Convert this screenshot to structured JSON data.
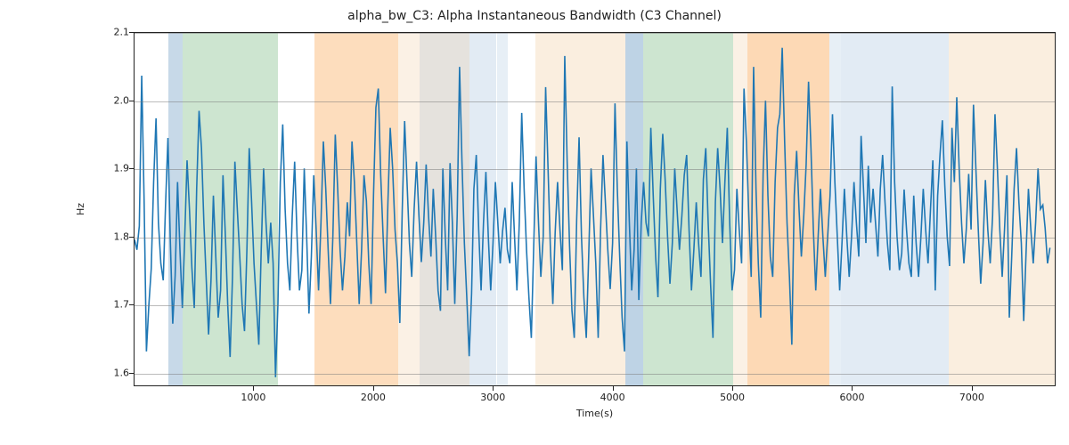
{
  "chart_data": {
    "type": "line",
    "title": "alpha_bw_C3: Alpha Instantaneous Bandwidth (C3 Channel)",
    "xlabel": "Time(s)",
    "ylabel": "Hz",
    "xlim": [
      0,
      7700
    ],
    "ylim": [
      1.58,
      2.1
    ],
    "xticks": [
      1000,
      2000,
      3000,
      4000,
      5000,
      6000,
      7000
    ],
    "yticks": [
      1.6,
      1.7,
      1.8,
      1.9,
      2.0,
      2.1
    ],
    "bands": [
      {
        "x0": 280,
        "x1": 400,
        "color": "rgba(70,130,180,0.30)"
      },
      {
        "x0": 400,
        "x1": 1200,
        "color": "rgba(90,170,100,0.30)"
      },
      {
        "x0": 1500,
        "x1": 2200,
        "color": "rgba(250,170,90,0.40)"
      },
      {
        "x0": 2200,
        "x1": 2800,
        "color": "rgba(240,200,150,0.25)"
      },
      {
        "x0": 2380,
        "x1": 3020,
        "color": "rgba(160,190,220,0.30)"
      },
      {
        "x0": 3030,
        "x1": 3120,
        "color": "rgba(160,190,220,0.25)"
      },
      {
        "x0": 3350,
        "x1": 4100,
        "color": "rgba(240,200,150,0.30)"
      },
      {
        "x0": 4100,
        "x1": 4250,
        "color": "rgba(70,130,180,0.35)"
      },
      {
        "x0": 4250,
        "x1": 5000,
        "color": "rgba(90,170,100,0.30)"
      },
      {
        "x0": 5000,
        "x1": 5120,
        "color": "rgba(240,200,150,0.25)"
      },
      {
        "x0": 5120,
        "x1": 5800,
        "color": "rgba(250,170,90,0.45)"
      },
      {
        "x0": 5800,
        "x1": 5900,
        "color": "rgba(160,190,220,0.25)"
      },
      {
        "x0": 5900,
        "x1": 6800,
        "color": "rgba(160,190,220,0.30)"
      },
      {
        "x0": 6800,
        "x1": 7700,
        "color": "rgba(240,200,150,0.30)"
      }
    ],
    "series": [
      {
        "name": "alpha_bw_C3",
        "color": "#1f77b4",
        "x_step": 20,
        "x_start": 0,
        "values": [
          1.795,
          1.78,
          1.815,
          2.037,
          1.852,
          1.63,
          1.698,
          1.752,
          1.88,
          1.974,
          1.82,
          1.76,
          1.735,
          1.846,
          1.945,
          1.792,
          1.671,
          1.742,
          1.88,
          1.78,
          1.694,
          1.8,
          1.912,
          1.84,
          1.754,
          1.694,
          1.87,
          1.985,
          1.93,
          1.82,
          1.738,
          1.655,
          1.734,
          1.86,
          1.77,
          1.68,
          1.72,
          1.89,
          1.8,
          1.7,
          1.622,
          1.74,
          1.91,
          1.84,
          1.772,
          1.7,
          1.66,
          1.78,
          1.93,
          1.85,
          1.76,
          1.7,
          1.64,
          1.78,
          1.9,
          1.82,
          1.76,
          1.82,
          1.76,
          1.592,
          1.7,
          1.88,
          1.965,
          1.84,
          1.76,
          1.72,
          1.83,
          1.91,
          1.8,
          1.72,
          1.75,
          1.9,
          1.8,
          1.686,
          1.77,
          1.89,
          1.81,
          1.72,
          1.82,
          1.94,
          1.87,
          1.78,
          1.7,
          1.8,
          1.95,
          1.87,
          1.78,
          1.72,
          1.77,
          1.85,
          1.8,
          1.94,
          1.88,
          1.79,
          1.7,
          1.78,
          1.89,
          1.852,
          1.76,
          1.7,
          1.86,
          1.99,
          2.018,
          1.89,
          1.8,
          1.716,
          1.85,
          1.96,
          1.9,
          1.81,
          1.76,
          1.672,
          1.838,
          1.97,
          1.88,
          1.79,
          1.74,
          1.84,
          1.91,
          1.83,
          1.762,
          1.82,
          1.906,
          1.83,
          1.77,
          1.87,
          1.8,
          1.72,
          1.69,
          1.9,
          1.8,
          1.72,
          1.908,
          1.82,
          1.7,
          1.83,
          2.05,
          1.91,
          1.79,
          1.71,
          1.623,
          1.715,
          1.87,
          1.92,
          1.81,
          1.72,
          1.82,
          1.895,
          1.8,
          1.72,
          1.79,
          1.88,
          1.82,
          1.76,
          1.808,
          1.842,
          1.78,
          1.76,
          1.88,
          1.8,
          1.72,
          1.822,
          1.982,
          1.87,
          1.78,
          1.71,
          1.65,
          1.78,
          1.918,
          1.822,
          1.74,
          1.8,
          2.02,
          1.9,
          1.78,
          1.7,
          1.805,
          1.88,
          1.81,
          1.75,
          2.066,
          1.91,
          1.786,
          1.69,
          1.65,
          1.824,
          1.946,
          1.8,
          1.71,
          1.65,
          1.77,
          1.9,
          1.83,
          1.76,
          1.65,
          1.81,
          1.92,
          1.85,
          1.78,
          1.722,
          1.79,
          1.996,
          1.87,
          1.77,
          1.68,
          1.63,
          1.94,
          1.822,
          1.72,
          1.78,
          1.9,
          1.706,
          1.82,
          1.88,
          1.82,
          1.8,
          1.96,
          1.86,
          1.77,
          1.71,
          1.87,
          1.951,
          1.884,
          1.8,
          1.73,
          1.79,
          1.9,
          1.84,
          1.78,
          1.83,
          1.89,
          1.92,
          1.81,
          1.72,
          1.78,
          1.85,
          1.79,
          1.74,
          1.884,
          1.93,
          1.82,
          1.73,
          1.65,
          1.85,
          1.93,
          1.87,
          1.79,
          1.88,
          1.96,
          1.82,
          1.72,
          1.75,
          1.87,
          1.81,
          1.76,
          2.018,
          1.94,
          1.83,
          1.74,
          2.05,
          1.87,
          1.76,
          1.68,
          1.892,
          2.0,
          1.86,
          1.77,
          1.74,
          1.88,
          1.96,
          1.98,
          2.078,
          1.94,
          1.82,
          1.74,
          1.64,
          1.86,
          1.926,
          1.84,
          1.77,
          1.83,
          1.906,
          2.028,
          1.93,
          1.81,
          1.72,
          1.8,
          1.87,
          1.8,
          1.74,
          1.8,
          1.86,
          1.98,
          1.88,
          1.8,
          1.72,
          1.79,
          1.87,
          1.8,
          1.74,
          1.8,
          1.88,
          1.82,
          1.77,
          1.948,
          1.87,
          1.79,
          1.904,
          1.82,
          1.87,
          1.82,
          1.77,
          1.87,
          1.92,
          1.85,
          1.79,
          1.75,
          2.021,
          1.88,
          1.8,
          1.75,
          1.775,
          1.869,
          1.81,
          1.76,
          1.74,
          1.86,
          1.79,
          1.74,
          1.8,
          1.87,
          1.81,
          1.76,
          1.838,
          1.912,
          1.72,
          1.86,
          1.921,
          1.971,
          1.876,
          1.8,
          1.756,
          1.96,
          1.88,
          2.005,
          1.9,
          1.82,
          1.76,
          1.81,
          1.892,
          1.81,
          1.994,
          1.9,
          1.81,
          1.73,
          1.79,
          1.883,
          1.81,
          1.76,
          1.83,
          1.98,
          1.9,
          1.81,
          1.74,
          1.81,
          1.89,
          1.68,
          1.77,
          1.87,
          1.93,
          1.85,
          1.79,
          1.675,
          1.774,
          1.87,
          1.81,
          1.76,
          1.82,
          1.9,
          1.84,
          1.846,
          1.812,
          1.76,
          1.783
        ]
      }
    ]
  }
}
